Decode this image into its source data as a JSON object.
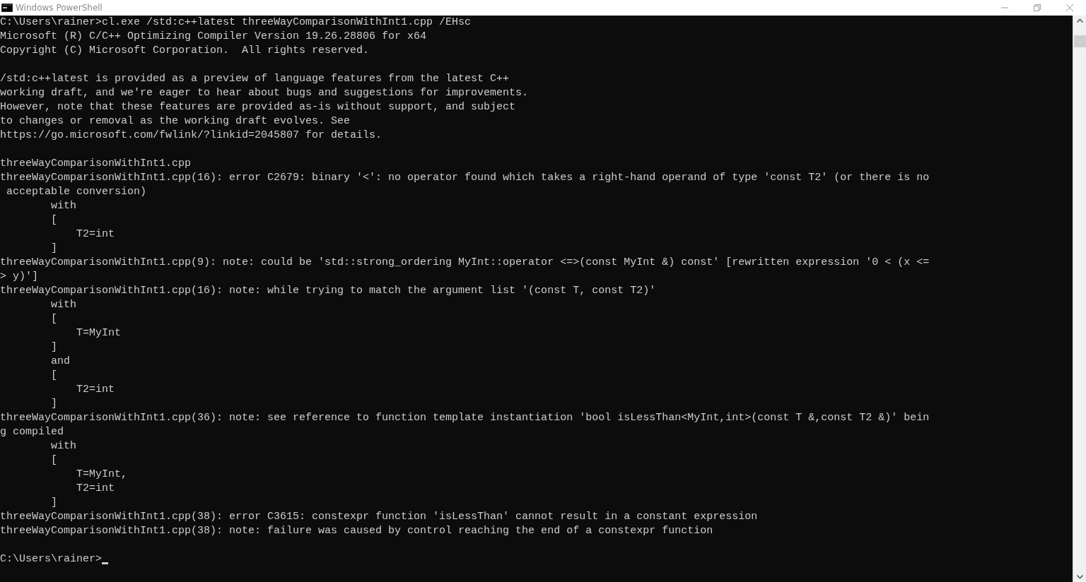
{
  "window": {
    "title": "Windows PowerShell"
  },
  "lines": [
    {
      "kind": "text",
      "text": "C:\\Users\\rainer>cl.exe /std:c++latest threeWayComparisonWithInt1.cpp /EHsc"
    },
    {
      "kind": "text",
      "text": "Microsoft (R) C/C++ Optimizing Compiler Version 19.26.28806 for x64"
    },
    {
      "kind": "text",
      "text": "Copyright (C) Microsoft Corporation.  All rights reserved."
    },
    {
      "kind": "blank"
    },
    {
      "kind": "text",
      "text": "/std:c++latest is provided as a preview of language features from the latest C++"
    },
    {
      "kind": "text",
      "text": "working draft, and we're eager to hear about bugs and suggestions for improvements."
    },
    {
      "kind": "text",
      "text": "However, note that these features are provided as-is without support, and subject"
    },
    {
      "kind": "text",
      "text": "to changes or removal as the working draft evolves. See"
    },
    {
      "kind": "text",
      "text": "https://go.microsoft.com/fwlink/?linkid=2045807 for details."
    },
    {
      "kind": "blank"
    },
    {
      "kind": "text",
      "text": "threeWayComparisonWithInt1.cpp"
    },
    {
      "kind": "text",
      "text": "threeWayComparisonWithInt1.cpp(16): error C2679: binary '<': no operator found which takes a right-hand operand of type 'const T2' (or there is no"
    },
    {
      "kind": "text",
      "text": " acceptable conversion)"
    },
    {
      "kind": "text",
      "text": "        with"
    },
    {
      "kind": "text",
      "text": "        ["
    },
    {
      "kind": "text",
      "text": "            T2=int"
    },
    {
      "kind": "text",
      "text": "        ]"
    },
    {
      "kind": "text",
      "text": "threeWayComparisonWithInt1.cpp(9): note: could be 'std::strong_ordering MyInt::operator <=>(const MyInt &) const' [rewritten expression '0 < (x <="
    },
    {
      "kind": "text",
      "text": "> y)']"
    },
    {
      "kind": "text",
      "text": "threeWayComparisonWithInt1.cpp(16): note: while trying to match the argument list '(const T, const T2)'"
    },
    {
      "kind": "text",
      "text": "        with"
    },
    {
      "kind": "text",
      "text": "        ["
    },
    {
      "kind": "text",
      "text": "            T=MyInt"
    },
    {
      "kind": "text",
      "text": "        ]"
    },
    {
      "kind": "text",
      "text": "        and"
    },
    {
      "kind": "text",
      "text": "        ["
    },
    {
      "kind": "text",
      "text": "            T2=int"
    },
    {
      "kind": "text",
      "text": "        ]"
    },
    {
      "kind": "text",
      "text": "threeWayComparisonWithInt1.cpp(36): note: see reference to function template instantiation 'bool isLessThan<MyInt,int>(const T &,const T2 &)' bein"
    },
    {
      "kind": "text",
      "text": "g compiled"
    },
    {
      "kind": "text",
      "text": "        with"
    },
    {
      "kind": "text",
      "text": "        ["
    },
    {
      "kind": "text",
      "text": "            T=MyInt,"
    },
    {
      "kind": "text",
      "text": "            T2=int"
    },
    {
      "kind": "text",
      "text": "        ]"
    },
    {
      "kind": "text",
      "text": "threeWayComparisonWithInt1.cpp(38): error C3615: constexpr function 'isLessThan' cannot result in a constant expression"
    },
    {
      "kind": "text",
      "text": "threeWayComparisonWithInt1.cpp(38): note: failure was caused by control reaching the end of a constexpr function"
    },
    {
      "kind": "blank"
    },
    {
      "kind": "prompt",
      "text": "C:\\Users\\rainer>",
      "cursor": true
    }
  ]
}
